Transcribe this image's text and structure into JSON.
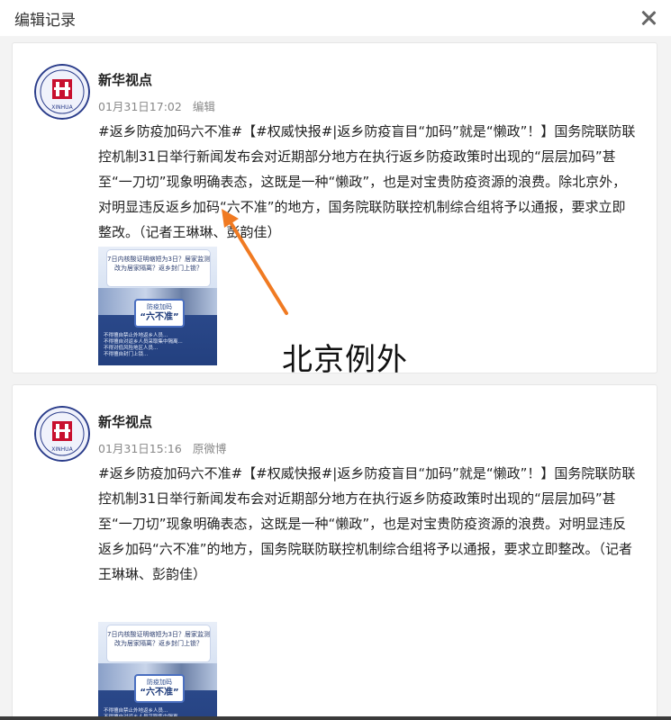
{
  "dialog": {
    "title": "编辑记录",
    "close_icon": "close-icon"
  },
  "records": [
    {
      "author": "新华视点",
      "time": "01月31日17:02",
      "action": "编辑",
      "text": "#返乡防疫加码六不准#【#权威快报#|返乡防疫盲目“加码”就是“懒政”！】国务院联防联控机制31日举行新闻发布会对近期部分地方在执行返乡防疫政策时出现的“层层加码”甚至“一刀切”现象明确表态，这既是一种“懒政”，也是对宝贵防疫资源的浪费。除北京外，对明显违反返乡加码“六不准”的地方，国务院联防联控机制综合组将予以通报，要求立即整改。（记者王琳琳、彭韵佳）",
      "thumb": {
        "banner": "7日内核酸证明缩短为3日？居家监测改为居家隔离？返乡封门上锁？",
        "badge_small": "防疫加码",
        "badge_big": "“六不准”",
        "lines": "不得擅自禁止外地返乡人员...\n不得擅自对返乡人员采取集中隔离...\n不得对低风险地区人员...\n不得擅自封门上锁..."
      }
    },
    {
      "author": "新华视点",
      "time": "01月31日15:16",
      "action": "原微博",
      "text": "#返乡防疫加码六不准#【#权威快报#|返乡防疫盲目“加码”就是“懒政”！】国务院联防联控机制31日举行新闻发布会对近期部分地方在执行返乡防疫政策时出现的“层层加码”甚至“一刀切”现象明确表态，这既是一种“懒政”，也是对宝贵防疫资源的浪费。对明显违反返乡加码“六不准”的地方，国务院联防联控机制综合组将予以通报，要求立即整改。（记者王琳琳、彭韵佳）",
      "thumb": {
        "banner": "7日内核酸证明缩短为3日？居家监测改为居家隔离？返乡封门上锁？",
        "badge_small": "防疫加码",
        "badge_big": "“六不准”",
        "lines": "不得擅自禁止外地返乡人员...\n不得擅自对返乡人员采取集中隔离...\n不得对低风险地区人员...\n不得擅自封门上锁..."
      }
    }
  ],
  "annotation": {
    "label": "北京例外",
    "arrow_color": "#f07a22"
  },
  "colors": {
    "accent": "#f07a22",
    "list_background": "#f3f3f3",
    "avatar_ring": "#2a3c8a",
    "avatar_emblem": "#c8102e"
  }
}
